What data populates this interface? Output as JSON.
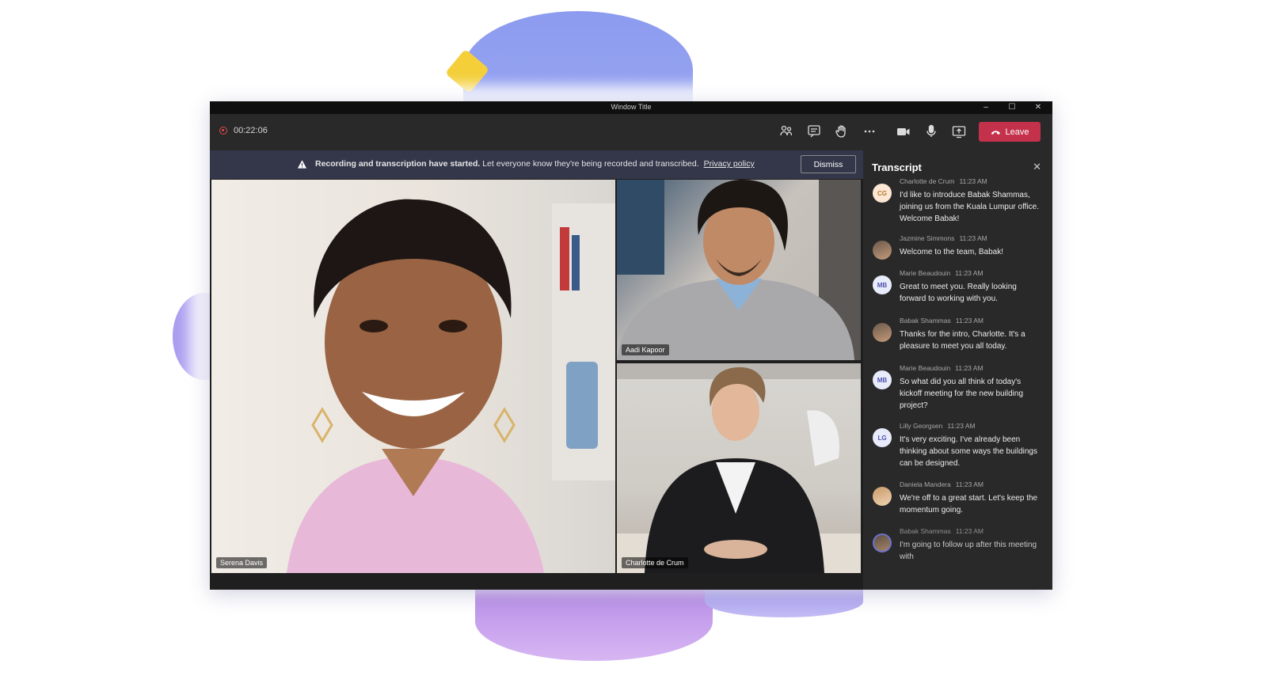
{
  "window": {
    "title": "Window Title",
    "controls": {
      "minimize": "–",
      "maximize": "☐",
      "close": "✕"
    }
  },
  "toolbar": {
    "timer": "00:22:06",
    "leave_label": "Leave",
    "icons": [
      "people-icon",
      "chat-icon",
      "raise-hand-icon",
      "more-icon",
      "camera-icon",
      "mic-icon",
      "share-icon"
    ]
  },
  "banner": {
    "bold_text": "Recording and transcription have started.",
    "text": "Let everyone know they're being recorded and transcribed.",
    "link": "Privacy policy",
    "dismiss_label": "Dismiss"
  },
  "participants": [
    {
      "name": "Serena Davis"
    },
    {
      "name": "Aadi Kapoor"
    },
    {
      "name": "Charlotte de Crum"
    }
  ],
  "transcript": {
    "title": "Transcript",
    "close": "✕",
    "messages": [
      {
        "name": "Charlotte de Crum",
        "time": "11:23 AM",
        "initials": "CG",
        "text": "I'd like to introduce Babak Shammas, joining us from the Kuala Lumpur office. Welcome Babak!"
      },
      {
        "name": "Jazmine Simmons",
        "time": "11:23 AM",
        "initials": "",
        "text": "Welcome to the team, Babak!"
      },
      {
        "name": "Marie Beaudouin",
        "time": "11:23 AM",
        "initials": "MB",
        "text": "Great to meet you. Really looking forward to working with you."
      },
      {
        "name": "Babak Shammas",
        "time": "11:23 AM",
        "initials": "",
        "text": "Thanks for the intro, Charlotte. It's a pleasure to meet you all today."
      },
      {
        "name": "Marie Beaudouin",
        "time": "11:23 AM",
        "initials": "MB",
        "text": "So what did you all think of today's kickoff meeting for the new building project?"
      },
      {
        "name": "Lilly Georgsen",
        "time": "11:23 AM",
        "initials": "LG",
        "text": "It's very exciting. I've already been thinking about some ways the buildings can be designed."
      },
      {
        "name": "Daniela Mandera",
        "time": "11:23 AM",
        "initials": "",
        "text": "We're off to a great start. Let's keep the momentum going."
      },
      {
        "name": "Babak Shammas",
        "time": "11:23 AM",
        "initials": "",
        "text": "I'm going to follow up after this meeting with"
      }
    ]
  },
  "colors": {
    "leave": "#c4314b",
    "banner": "#34374a",
    "pane": "#292929",
    "accent": "#4f52b2"
  }
}
